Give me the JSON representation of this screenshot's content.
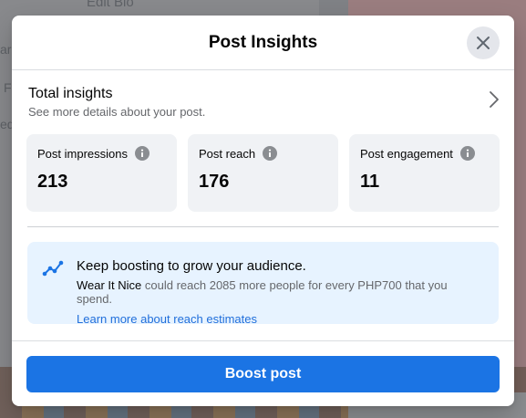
{
  "background": {
    "bio_text": "Edit Bio",
    "left_fragments": [
      "are",
      "F",
      "ed"
    ]
  },
  "modal": {
    "title": "Post Insights",
    "close_icon": "close-icon"
  },
  "total_insights": {
    "title": "Total insights",
    "subtitle": "See more details about your post."
  },
  "metrics": [
    {
      "label": "Post impressions",
      "value": "213"
    },
    {
      "label": "Post reach",
      "value": "176"
    },
    {
      "label": "Post engagement",
      "value": "11"
    }
  ],
  "boost_tip": {
    "title": "Keep boosting to grow your audience.",
    "page_name": "Wear It Nice",
    "body_rest": " could reach 2085 more people for every PHP700 that you spend.",
    "link": "Learn more about reach estimates"
  },
  "footer": {
    "boost_label": "Boost post"
  },
  "colors": {
    "accent": "#1b74e4",
    "link": "#216fdb",
    "tip_bg": "#e7f3ff",
    "card_bg": "#f0f2f5"
  }
}
